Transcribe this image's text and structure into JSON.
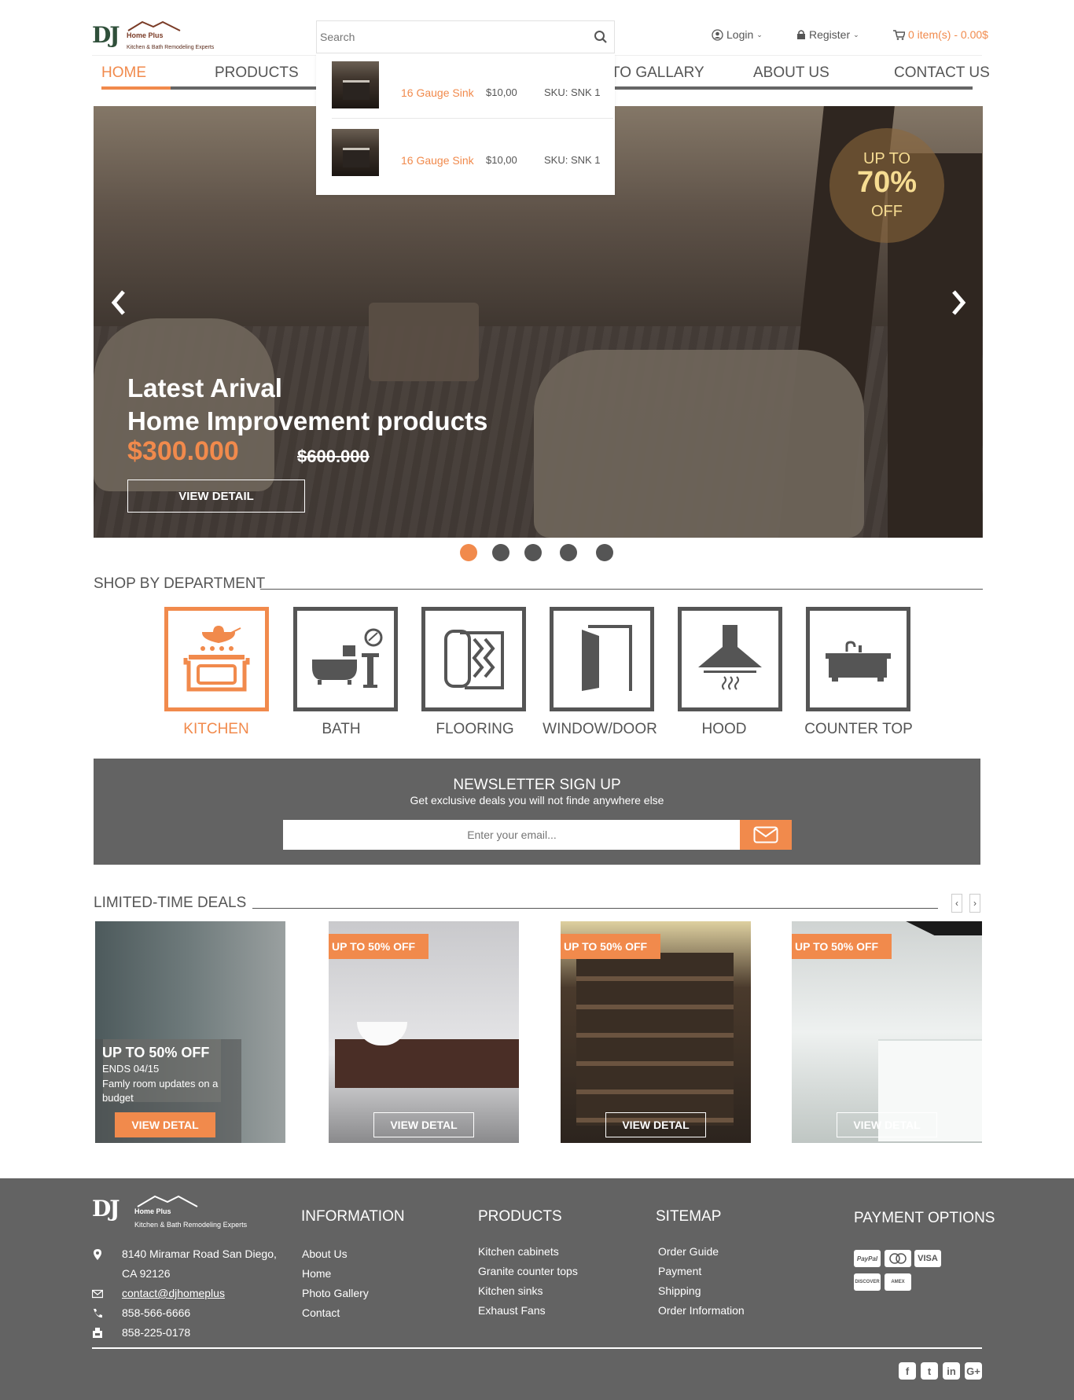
{
  "brand": {
    "logo_main": "DJ",
    "logo_sub1": "Home Plus",
    "logo_sub2": "Kitchen & Bath Remodeling Experts"
  },
  "header": {
    "search_placeholder": "Search",
    "login": "Login",
    "register": "Register",
    "cart": "0 item(s) - 0.00$"
  },
  "nav": {
    "items": [
      "HOME",
      "PRODUCTS",
      "TO GALLARY",
      "ABOUT US",
      "CONTACT US"
    ]
  },
  "search_results": [
    {
      "name": "16 Gauge Sink",
      "price": "$10,00",
      "sku": "SKU: SNK 1"
    },
    {
      "name": "16 Gauge Sink",
      "price": "$10,00",
      "sku": "SKU: SNK 1"
    }
  ],
  "hero": {
    "badge_line1": "UP TO",
    "badge_line2": "70%",
    "badge_line3": "OFF",
    "title_line1": "Latest Arival",
    "title_line2": "Home Improvement products",
    "price": "$300.000",
    "old_price": "$600.000",
    "button": "VIEW DETAIL",
    "slides": 5,
    "active_slide": 1
  },
  "departments": {
    "title": "SHOP BY DEPARTMENT",
    "items": [
      {
        "label": "KITCHEN",
        "icon": "kitchen-icon"
      },
      {
        "label": "BATH",
        "icon": "bath-icon"
      },
      {
        "label": "FLOORING",
        "icon": "flooring-icon"
      },
      {
        "label": "WINDOW/DOOR",
        "icon": "door-icon"
      },
      {
        "label": "HOOD",
        "icon": "hood-icon"
      },
      {
        "label": "COUNTER TOP",
        "icon": "countertop-icon"
      }
    ]
  },
  "newsletter": {
    "title": "NEWSLETTER SIGN UP",
    "subtitle": "Get exclusive deals you will not finde anywhere else",
    "placeholder": "Enter your email..."
  },
  "deals": {
    "title": "LIMITED-TIME DEALS",
    "prev": "‹",
    "next": "›",
    "featured": {
      "title": "UP TO 50% OFF",
      "ends": "ENDS 04/15",
      "desc": "Famly room updates on a budget",
      "button": "VIEW DETAL"
    },
    "items": [
      {
        "tag": "UP TO 50% OFF",
        "button": "VIEW DETAL"
      },
      {
        "tag": "UP TO 50% OFF",
        "button": "VIEW DETAL"
      },
      {
        "tag": "UP TO 50% OFF",
        "button": "VIEW DETAL"
      }
    ]
  },
  "footer": {
    "address": "8140 Miramar Road San Diego,",
    "address2": "CA 92126",
    "email": "contact@djhomeplus",
    "phone": "858-566-6666",
    "fax": "858-225-0178",
    "information": {
      "title": "INFORMATION",
      "links": [
        "About Us",
        "Home",
        "Photo Gallery",
        "Contact"
      ]
    },
    "products": {
      "title": "PRODUCTS",
      "links": [
        "Kitchen cabinets",
        "Granite counter tops",
        "Kitchen sinks",
        "Exhaust Fans"
      ]
    },
    "sitemap": {
      "title": "SITEMAP",
      "links": [
        "Order Guide",
        "Payment",
        "Shipping",
        "Order Information"
      ]
    },
    "payment": {
      "title": "PAYMENT OPTIONS",
      "methods": [
        "PayPal",
        "MC",
        "VISA",
        "DISCOVER",
        "AMEX"
      ]
    },
    "social": [
      "facebook-icon",
      "twitter-icon",
      "linkedin-icon",
      "googleplus-icon"
    ]
  },
  "colors": {
    "accent": "#f18a4c",
    "dark": "#555555",
    "footer": "#636363"
  }
}
